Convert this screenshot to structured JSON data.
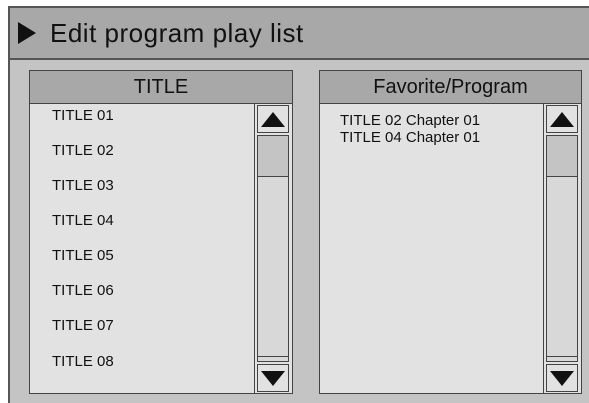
{
  "header": {
    "title": "Edit program play list",
    "icon": "play-icon"
  },
  "left_panel": {
    "header": "TITLE",
    "items": [
      "TITLE 01",
      "TITLE 02",
      "TITLE 03",
      "TITLE 04",
      "TITLE 05",
      "TITLE 06",
      "TITLE 07",
      "TITLE 08"
    ]
  },
  "right_panel": {
    "header": "Favorite/Program",
    "items": [
      "TITLE  02 Chapter 01",
      "TITLE 04 Chapter 01"
    ]
  },
  "colors": {
    "background": "#c4c4c4",
    "header_bar": "#a8a8a8",
    "panel": "#e2e2e2"
  }
}
